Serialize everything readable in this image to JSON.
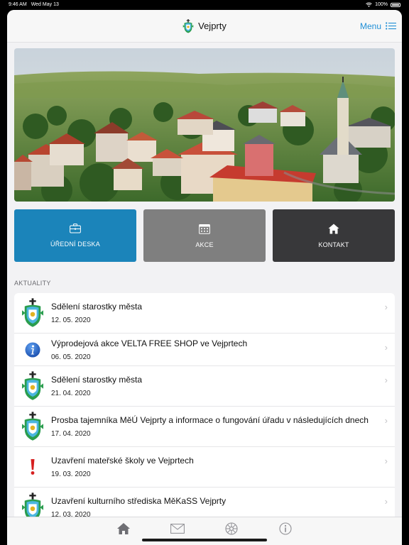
{
  "status": {
    "time": "9:46 AM",
    "date": "Wed May 13",
    "battery": "100%"
  },
  "header": {
    "title": "Vejprty",
    "menu_label": "Menu"
  },
  "tiles": [
    {
      "label": "ÚŘEDNÍ DESKA",
      "icon": "briefcase-icon",
      "color": "#1b84ba"
    },
    {
      "label": "AKCE",
      "icon": "calendar-icon",
      "color": "#7f7f7f"
    },
    {
      "label": "KONTAKT",
      "icon": "home-icon",
      "color": "#38383a"
    }
  ],
  "section_label": "AKTUALITY",
  "news": [
    {
      "title": "Sdělení starostky města",
      "date": "12. 05. 2020",
      "icon": "crest-icon"
    },
    {
      "title": "Výprodejová akce VELTA FREE SHOP ve Vejprtech",
      "date": "06. 05. 2020",
      "icon": "info-icon"
    },
    {
      "title": "Sdělení starostky města",
      "date": "21. 04. 2020",
      "icon": "crest-icon"
    },
    {
      "title": "Prosba tajemníka MěÚ Vejprty a informace o fungování úřadu v následujících dnech",
      "date": "17. 04. 2020",
      "icon": "crest-icon"
    },
    {
      "title": "Uzavření mateřské školy ve Vejprtech",
      "date": "19. 03. 2020",
      "icon": "exclamation-icon"
    },
    {
      "title": "Uzavření kulturního střediska MěKaSS Vejprty",
      "date": "12. 03. 2020",
      "icon": "crest-icon"
    }
  ],
  "tabbar": [
    "home-tab-icon",
    "mail-tab-icon",
    "wheel-tab-icon",
    "info-tab-icon"
  ],
  "colors": {
    "accent": "#1f8fd6",
    "info_blue": "#1e63c4",
    "alert_red": "#d61f1f"
  }
}
